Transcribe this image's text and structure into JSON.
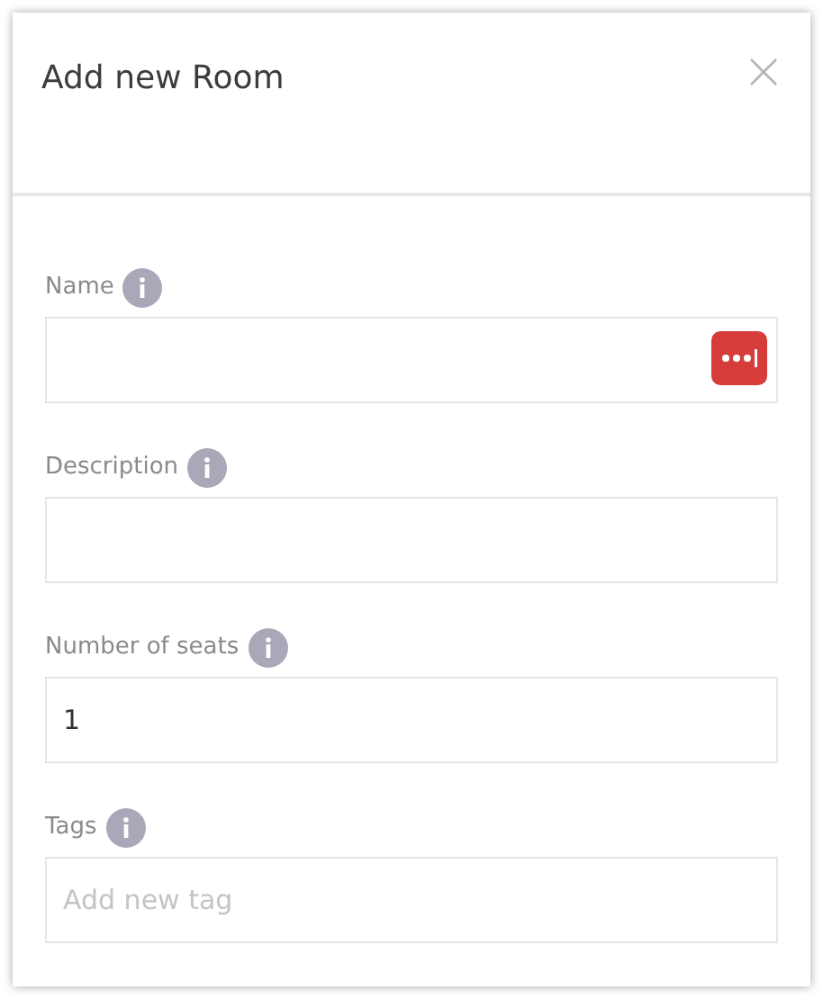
{
  "dialog": {
    "title": "Add new Room"
  },
  "fields": [
    {
      "label": "Name",
      "autofill_badge": true
    },
    {
      "label": "Description",
      "autofill_badge": false
    },
    {
      "label": "Number of seats",
      "value": "1",
      "autofill_badge": false
    },
    {
      "label": "Tags",
      "placeholder": "Add new tag",
      "autofill_badge": false
    }
  ]
}
